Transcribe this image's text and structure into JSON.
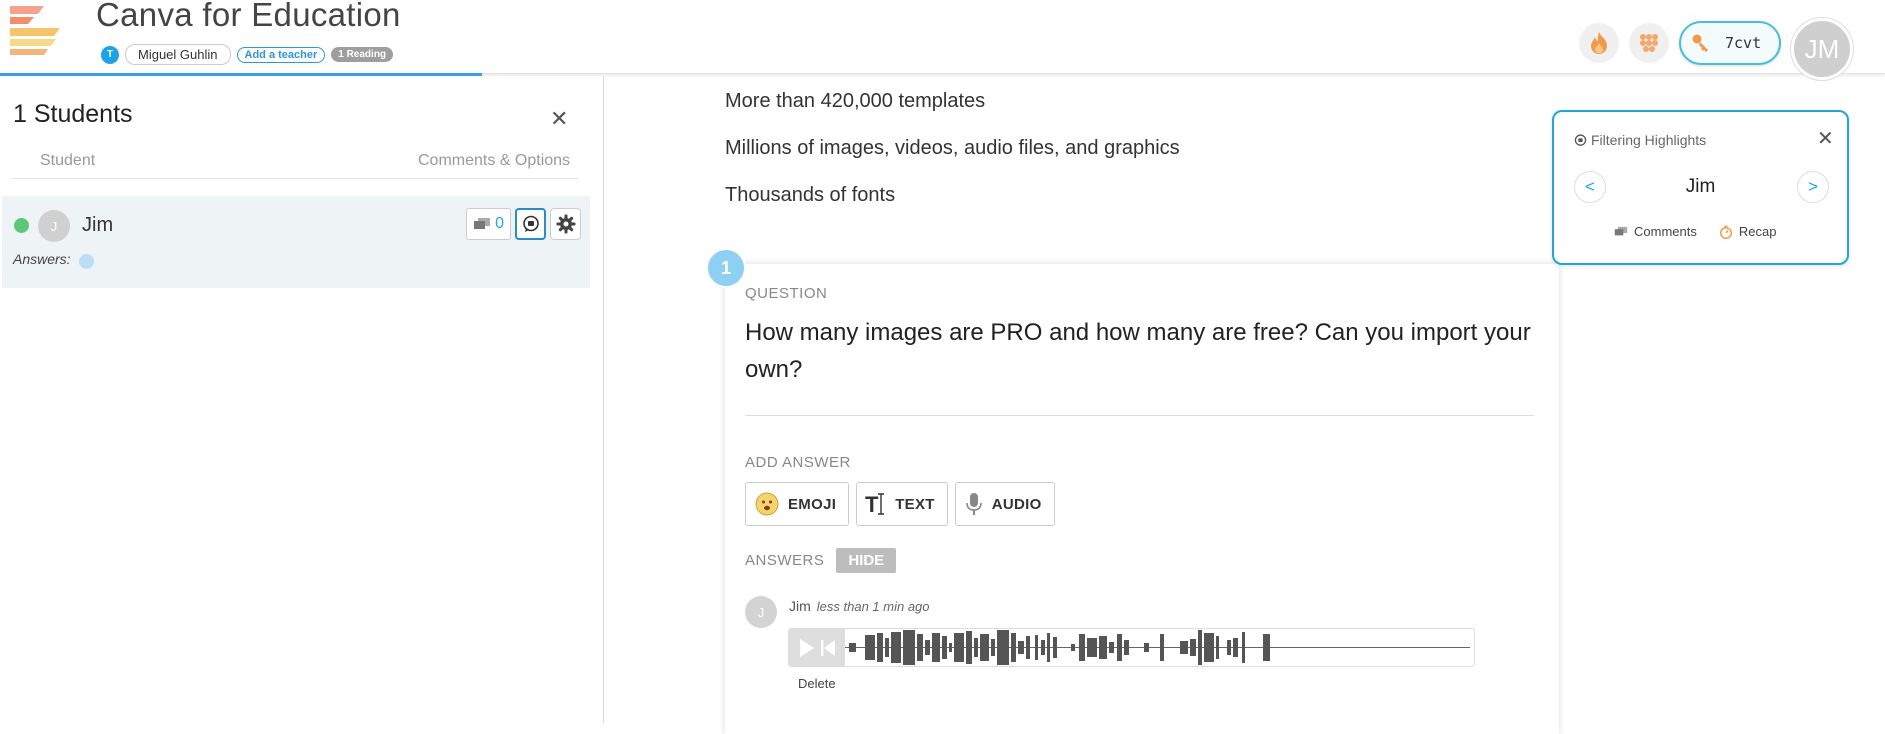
{
  "header": {
    "title": "Canva for Education",
    "teacher_badge": "T",
    "teacher_name": "Miguel Guhlin",
    "add_teacher": "Add a teacher",
    "reading_count": "1 Reading",
    "class_code": "7cvt",
    "user_initials": "JM"
  },
  "students_panel": {
    "title": "1 Students",
    "col_student": "Student",
    "col_options": "Comments & Options",
    "students": [
      {
        "initial": "J",
        "name": "Jim",
        "comment_count": "0",
        "answers_label": "Answers:",
        "status": "online"
      }
    ]
  },
  "content": {
    "features": [
      "More than 420,000 templates",
      "Millions of images, videos, audio files, and graphics",
      "Thousands of fonts"
    ],
    "question": {
      "number": "1",
      "label": "QUESTION",
      "text": "How many images are PRO and how many are free? Can you import your own?",
      "add_answer_label": "ADD ANSWER",
      "buttons": {
        "emoji": "EMOJI",
        "text": "TEXT",
        "audio": "AUDIO"
      },
      "answers_label": "ANSWERS",
      "hide_label": "HIDE",
      "response": {
        "initial": "J",
        "name": "Jim",
        "time": "less than 1 min ago",
        "delete": "Delete"
      }
    }
  },
  "filter": {
    "title": "Filtering Highlights",
    "prev": "<",
    "next": ">",
    "student": "Jim",
    "comments": "Comments",
    "recap": "Recap"
  },
  "colors": {
    "accent": "#1fa6da",
    "online": "#5cc77a",
    "progress": "#3aa0e6"
  }
}
